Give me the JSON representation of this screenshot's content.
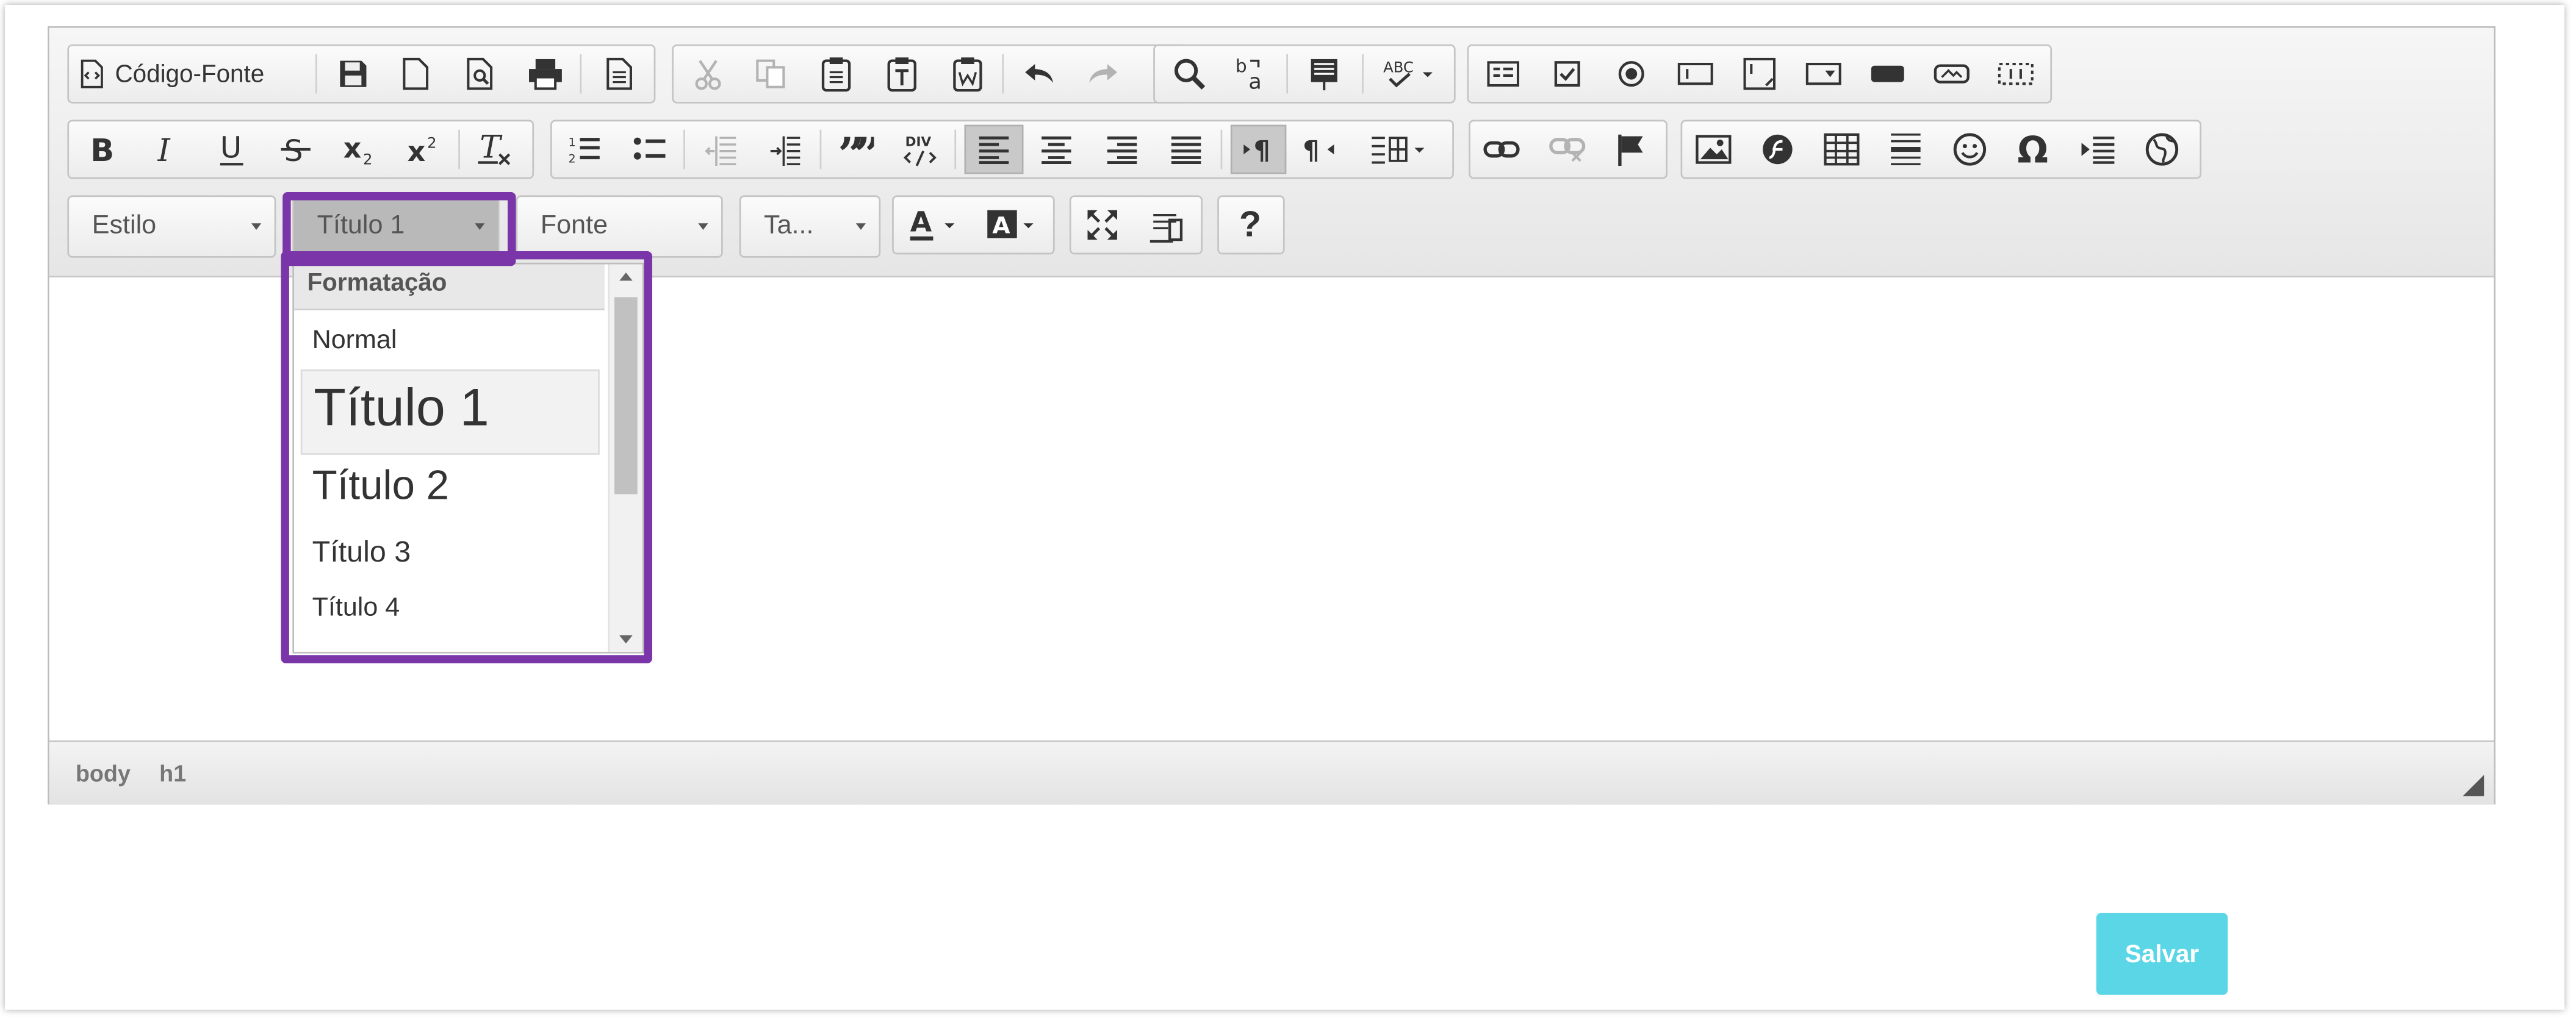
{
  "toolbar": {
    "source_label": "Código-Fonte",
    "ellipsis_text": "…",
    "combos": {
      "style": "Estilo",
      "format": "Título 1",
      "font": "Fonte",
      "size": "Ta..."
    },
    "help_label": "?"
  },
  "format_dropdown": {
    "header": "Formatação",
    "items": [
      "Normal",
      "Título 1",
      "Título 2",
      "Título 3",
      "Título 4"
    ],
    "selected": "Título 1"
  },
  "statusbar": {
    "path": [
      "body",
      "h1"
    ]
  },
  "actions": {
    "save_label": "Salvar"
  },
  "colors": {
    "highlight": "#7a35a8",
    "save_button": "#5bd6e6"
  },
  "icons": [
    "source-icon",
    "save-icon",
    "new-page-icon",
    "preview-icon",
    "print-icon",
    "templates-icon",
    "cut-icon",
    "copy-icon",
    "paste-icon",
    "paste-text-icon",
    "paste-word-icon",
    "undo-icon",
    "redo-icon",
    "find-icon",
    "replace-icon",
    "select-all-icon",
    "spellcheck-icon",
    "form-icon",
    "checkbox-icon",
    "radio-icon",
    "textfield-icon",
    "textarea-icon",
    "select-icon",
    "button-icon",
    "image-button-icon",
    "hidden-field-icon",
    "bold-icon",
    "italic-icon",
    "underline-icon",
    "strike-icon",
    "subscript-icon",
    "superscript-icon",
    "remove-format-icon",
    "numbered-list-icon",
    "bulleted-list-icon",
    "outdent-icon",
    "indent-icon",
    "blockquote-icon",
    "div-icon",
    "align-left-icon",
    "align-center-icon",
    "align-right-icon",
    "justify-icon",
    "ltr-icon",
    "rtl-icon",
    "language-icon",
    "link-icon",
    "unlink-icon",
    "anchor-icon",
    "image-icon",
    "flash-icon",
    "table-icon",
    "horizontal-rule-icon",
    "smiley-icon",
    "special-char-icon",
    "page-break-icon",
    "iframe-icon",
    "text-color-icon",
    "background-color-icon",
    "maximize-icon",
    "show-blocks-icon",
    "help-icon"
  ]
}
